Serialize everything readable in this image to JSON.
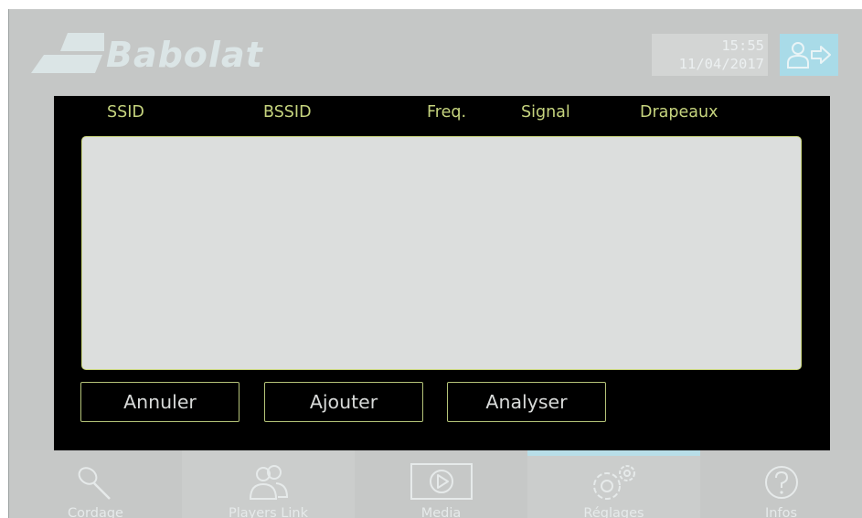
{
  "brand": {
    "logo_text": "Babolat"
  },
  "header": {
    "time": "15:55",
    "date": "11/04/2017",
    "logout_icon": "user-logout-icon"
  },
  "wifi_dialog": {
    "columns": [
      "SSID",
      "BSSID",
      "Freq.",
      "Signal",
      "Drapeaux"
    ],
    "networks": [],
    "buttons": {
      "cancel": "Annuler",
      "add": "Ajouter",
      "scan": "Analyser"
    }
  },
  "nav": {
    "active_tab": "Réglages",
    "tabs": [
      {
        "label": "Cordage",
        "icon": "racket-icon"
      },
      {
        "label": "Players Link",
        "icon": "players-icon"
      },
      {
        "label": "Media",
        "icon": "play-icon"
      },
      {
        "label": "Réglages",
        "icon": "gears-icon"
      },
      {
        "label": "Infos",
        "icon": "help-icon"
      }
    ]
  },
  "colors": {
    "background": "#c5c7c6",
    "dialog": "#000000",
    "accent_green": "#c6d47e",
    "accent_blue": "#a9dbe8"
  }
}
